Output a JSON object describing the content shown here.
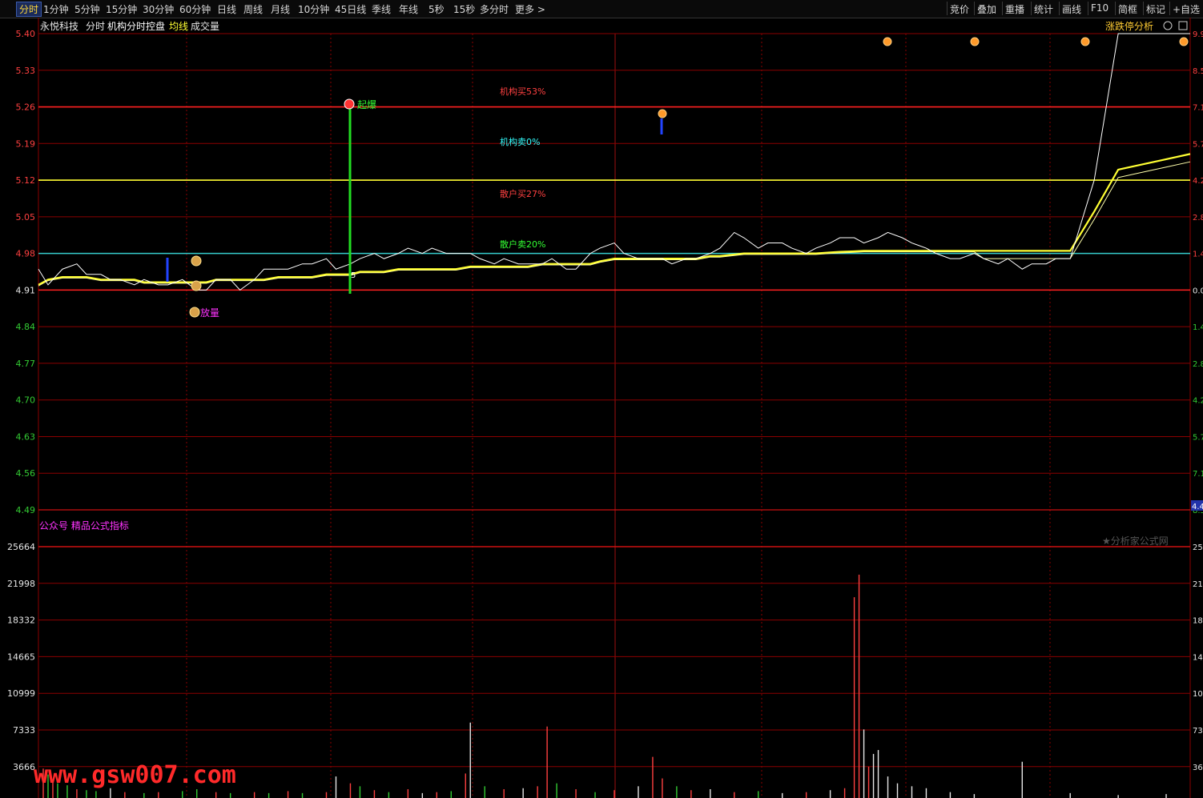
{
  "toolbar": {
    "left_items": [
      "分时",
      "1分钟",
      "5分钟",
      "15分钟",
      "30分钟",
      "60分钟",
      "日线",
      "周线",
      "月线",
      "10分钟",
      "45日线",
      "季线",
      "年线",
      "5秒",
      "15秒",
      "多分时",
      "更多 >"
    ],
    "right_items": [
      "竞价",
      "叠加",
      "重播",
      "统计",
      "画线",
      "F10",
      "简框",
      "标记",
      "+自选"
    ]
  },
  "header": {
    "stock_name": "永悦科技",
    "mode": "分时",
    "indicator": "机构分时控盘",
    "avg_label": "均线",
    "vol_label": "成交量",
    "right_button": "涨跌停分析"
  },
  "annotations": {
    "inst_buy": "机构买53%",
    "inst_sell": "机构卖0%",
    "retail_buy": "散户买27%",
    "retail_sell": "散户卖20%",
    "explode": "起爆",
    "volume_tag": "放量",
    "small_5": "5"
  },
  "watermarks": {
    "indicator_source": "公众号 精品公式指标",
    "site_right": "★分析家公式网",
    "site_bottom": "www.gsw007.com"
  },
  "colors": {
    "price_line": "#ffffff",
    "avg_line": "#ffff33",
    "grid": "#8b0000",
    "up_tick": "#ff4040",
    "down_tick": "#33cc33",
    "neutral_tick": "#e6e6e6",
    "cyan": "#33cccc",
    "annotation_red": "#ff4040",
    "annotation_cyan": "#33ffff",
    "annotation_green": "#33ff33",
    "magenta": "#ff33ff"
  },
  "chart_data": [
    {
      "type": "line",
      "title": "",
      "y_ticks": [
        "5.40",
        "5.33",
        "5.26",
        "5.19",
        "5.12",
        "5.05",
        "4.98",
        "4.91",
        "4.84",
        "4.77",
        "4.70",
        "4.63",
        "4.56",
        "4.49"
      ],
      "right_ticks": [
        "9.9",
        "8.5",
        "7.1",
        "5.7",
        "4.2",
        "2.8",
        "1.4",
        "0.0",
        "1.4",
        "2.8",
        "4.2",
        "5.7",
        "7.1",
        "8.5"
      ],
      "right_current": "4.4",
      "ylim": [
        4.49,
        5.4
      ],
      "prev_close": 4.91,
      "reference_lines": [
        {
          "value": 5.26,
          "color": "#ff2020"
        },
        {
          "value": 5.12,
          "color": "#ffff33"
        },
        {
          "value": 4.98,
          "color": "#33cccc"
        },
        {
          "value": 4.91,
          "color": "#ff2020"
        }
      ],
      "x": [
        0,
        2,
        5,
        8,
        10,
        13,
        15,
        17,
        20,
        22,
        25,
        27,
        30,
        33,
        35,
        37,
        40,
        42,
        45,
        47,
        50,
        52,
        55,
        57,
        60,
        62,
        65,
        67,
        70,
        72,
        75,
        77,
        80,
        82,
        85,
        87,
        90,
        92,
        95,
        97,
        100,
        102,
        105,
        107,
        110,
        112,
        115,
        117,
        120,
        122,
        125,
        127,
        130,
        132,
        135,
        137,
        140,
        142,
        145,
        147,
        150,
        152,
        155,
        157,
        160,
        162,
        165,
        167,
        170,
        172,
        175,
        177,
        180,
        182,
        185,
        187,
        190,
        192,
        195,
        197,
        200,
        202,
        205,
        207,
        210,
        212,
        215,
        220,
        225,
        230,
        235,
        240
      ],
      "series": [
        {
          "values": [
            4.95,
            4.92,
            4.95,
            4.96,
            4.94,
            4.94,
            4.93,
            4.93,
            4.92,
            4.93,
            4.92,
            4.92,
            4.93,
            4.91,
            4.91,
            4.93,
            4.93,
            4.91,
            4.93,
            4.95,
            4.95,
            4.95,
            4.96,
            4.96,
            4.97,
            4.95,
            4.96,
            4.97,
            4.98,
            4.97,
            4.98,
            4.99,
            4.98,
            4.99,
            4.98,
            4.98,
            4.98,
            4.97,
            4.96,
            4.97,
            4.96,
            4.96,
            4.96,
            4.97,
            4.95,
            4.95,
            4.98,
            4.99,
            5.0,
            4.98,
            4.97,
            4.97,
            4.97,
            4.96,
            4.97,
            4.97,
            4.98,
            4.99,
            5.02,
            5.01,
            4.99,
            5.0,
            5.0,
            4.99,
            4.98,
            4.99,
            5.0,
            5.01,
            5.01,
            5.0,
            5.01,
            5.02,
            5.01,
            5.0,
            4.99,
            4.98,
            4.97,
            4.97,
            4.98,
            4.97,
            4.96,
            4.97,
            4.95,
            4.96,
            4.96,
            4.97,
            4.97,
            5.12,
            5.4,
            5.4,
            5.4,
            5.4
          ]
        },
        {
          "values": [
            4.92,
            4.93,
            4.935,
            4.935,
            4.935,
            4.93,
            4.93,
            4.93,
            4.93,
            4.925,
            4.925,
            4.925,
            4.925,
            4.925,
            4.925,
            4.93,
            4.93,
            4.93,
            4.93,
            4.93,
            4.935,
            4.935,
            4.935,
            4.935,
            4.94,
            4.94,
            4.94,
            4.945,
            4.945,
            4.945,
            4.95,
            4.95,
            4.95,
            4.95,
            4.95,
            4.95,
            4.955,
            4.955,
            4.955,
            4.955,
            4.955,
            4.955,
            4.96,
            4.96,
            4.96,
            4.96,
            4.96,
            4.965,
            4.97,
            4.97,
            4.97,
            4.97,
            4.97,
            4.97,
            4.97,
            4.97,
            4.975,
            4.975,
            4.978,
            4.98,
            4.98,
            4.98,
            4.98,
            4.98,
            4.98,
            4.98,
            4.982,
            4.983,
            4.984,
            4.985,
            4.985,
            4.985,
            4.985,
            4.985,
            4.985,
            4.985,
            4.985,
            4.985,
            4.985,
            4.985,
            4.985,
            4.985,
            4.985,
            4.985,
            4.985,
            4.985,
            4.985,
            5.06,
            5.14,
            5.15,
            5.16,
            5.17
          ]
        }
      ]
    },
    {
      "type": "bar",
      "title": "",
      "y_ticks": [
        "25664",
        "21998",
        "18332",
        "14665",
        "10999",
        "7333",
        "3666"
      ],
      "right_ticks": [
        "25",
        "21",
        "18",
        "14",
        "10",
        "73",
        "36"
      ],
      "ylim": [
        0,
        29330
      ],
      "bars": [
        {
          "x": 1,
          "value": 3000,
          "dir": "up"
        },
        {
          "x": 2,
          "value": 2400,
          "dir": "down"
        },
        {
          "x": 3,
          "value": 1800,
          "dir": "up"
        },
        {
          "x": 4,
          "value": 1500,
          "dir": "down"
        },
        {
          "x": 6,
          "value": 1300,
          "dir": "down"
        },
        {
          "x": 8,
          "value": 900,
          "dir": "up"
        },
        {
          "x": 10,
          "value": 800,
          "dir": "down"
        },
        {
          "x": 12,
          "value": 700,
          "dir": "down"
        },
        {
          "x": 15,
          "value": 1000,
          "dir": "neutral"
        },
        {
          "x": 18,
          "value": 600,
          "dir": "up"
        },
        {
          "x": 22,
          "value": 500,
          "dir": "down"
        },
        {
          "x": 25,
          "value": 600,
          "dir": "up"
        },
        {
          "x": 30,
          "value": 700,
          "dir": "down"
        },
        {
          "x": 33,
          "value": 900,
          "dir": "down"
        },
        {
          "x": 37,
          "value": 600,
          "dir": "up"
        },
        {
          "x": 40,
          "value": 500,
          "dir": "down"
        },
        {
          "x": 45,
          "value": 600,
          "dir": "up"
        },
        {
          "x": 48,
          "value": 500,
          "dir": "down"
        },
        {
          "x": 52,
          "value": 700,
          "dir": "up"
        },
        {
          "x": 55,
          "value": 500,
          "dir": "down"
        },
        {
          "x": 60,
          "value": 600,
          "dir": "up"
        },
        {
          "x": 62,
          "value": 2200,
          "dir": "neutral"
        },
        {
          "x": 65,
          "value": 1500,
          "dir": "up"
        },
        {
          "x": 67,
          "value": 1200,
          "dir": "down"
        },
        {
          "x": 70,
          "value": 800,
          "dir": "up"
        },
        {
          "x": 73,
          "value": 600,
          "dir": "down"
        },
        {
          "x": 77,
          "value": 900,
          "dir": "up"
        },
        {
          "x": 80,
          "value": 500,
          "dir": "neutral"
        },
        {
          "x": 83,
          "value": 600,
          "dir": "up"
        },
        {
          "x": 86,
          "value": 700,
          "dir": "down"
        },
        {
          "x": 89,
          "value": 2500,
          "dir": "up"
        },
        {
          "x": 90,
          "value": 7700,
          "dir": "neutral"
        },
        {
          "x": 93,
          "value": 1200,
          "dir": "down"
        },
        {
          "x": 97,
          "value": 900,
          "dir": "up"
        },
        {
          "x": 101,
          "value": 1000,
          "dir": "neutral"
        },
        {
          "x": 104,
          "value": 1200,
          "dir": "up"
        },
        {
          "x": 106,
          "value": 7300,
          "dir": "up"
        },
        {
          "x": 108,
          "value": 1500,
          "dir": "down"
        },
        {
          "x": 112,
          "value": 900,
          "dir": "up"
        },
        {
          "x": 116,
          "value": 600,
          "dir": "down"
        },
        {
          "x": 120,
          "value": 800,
          "dir": "up"
        },
        {
          "x": 125,
          "value": 1200,
          "dir": "neutral"
        },
        {
          "x": 128,
          "value": 4200,
          "dir": "up"
        },
        {
          "x": 130,
          "value": 2000,
          "dir": "up"
        },
        {
          "x": 133,
          "value": 1200,
          "dir": "down"
        },
        {
          "x": 136,
          "value": 800,
          "dir": "up"
        },
        {
          "x": 140,
          "value": 900,
          "dir": "neutral"
        },
        {
          "x": 145,
          "value": 600,
          "dir": "up"
        },
        {
          "x": 150,
          "value": 700,
          "dir": "down"
        },
        {
          "x": 155,
          "value": 500,
          "dir": "neutral"
        },
        {
          "x": 160,
          "value": 600,
          "dir": "up"
        },
        {
          "x": 165,
          "value": 800,
          "dir": "neutral"
        },
        {
          "x": 168,
          "value": 1000,
          "dir": "up"
        },
        {
          "x": 170,
          "value": 20500,
          "dir": "up"
        },
        {
          "x": 171,
          "value": 22800,
          "dir": "up"
        },
        {
          "x": 172,
          "value": 7000,
          "dir": "neutral"
        },
        {
          "x": 173,
          "value": 3200,
          "dir": "up"
        },
        {
          "x": 174,
          "value": 4500,
          "dir": "neutral"
        },
        {
          "x": 175,
          "value": 4900,
          "dir": "neutral"
        },
        {
          "x": 177,
          "value": 2200,
          "dir": "neutral"
        },
        {
          "x": 179,
          "value": 1500,
          "dir": "neutral"
        },
        {
          "x": 182,
          "value": 1200,
          "dir": "neutral"
        },
        {
          "x": 185,
          "value": 1000,
          "dir": "neutral"
        },
        {
          "x": 190,
          "value": 600,
          "dir": "neutral"
        },
        {
          "x": 195,
          "value": 400,
          "dir": "neutral"
        },
        {
          "x": 205,
          "value": 3700,
          "dir": "neutral"
        },
        {
          "x": 215,
          "value": 500,
          "dir": "neutral"
        },
        {
          "x": 225,
          "value": 300,
          "dir": "neutral"
        },
        {
          "x": 235,
          "value": 400,
          "dir": "neutral"
        }
      ]
    }
  ]
}
